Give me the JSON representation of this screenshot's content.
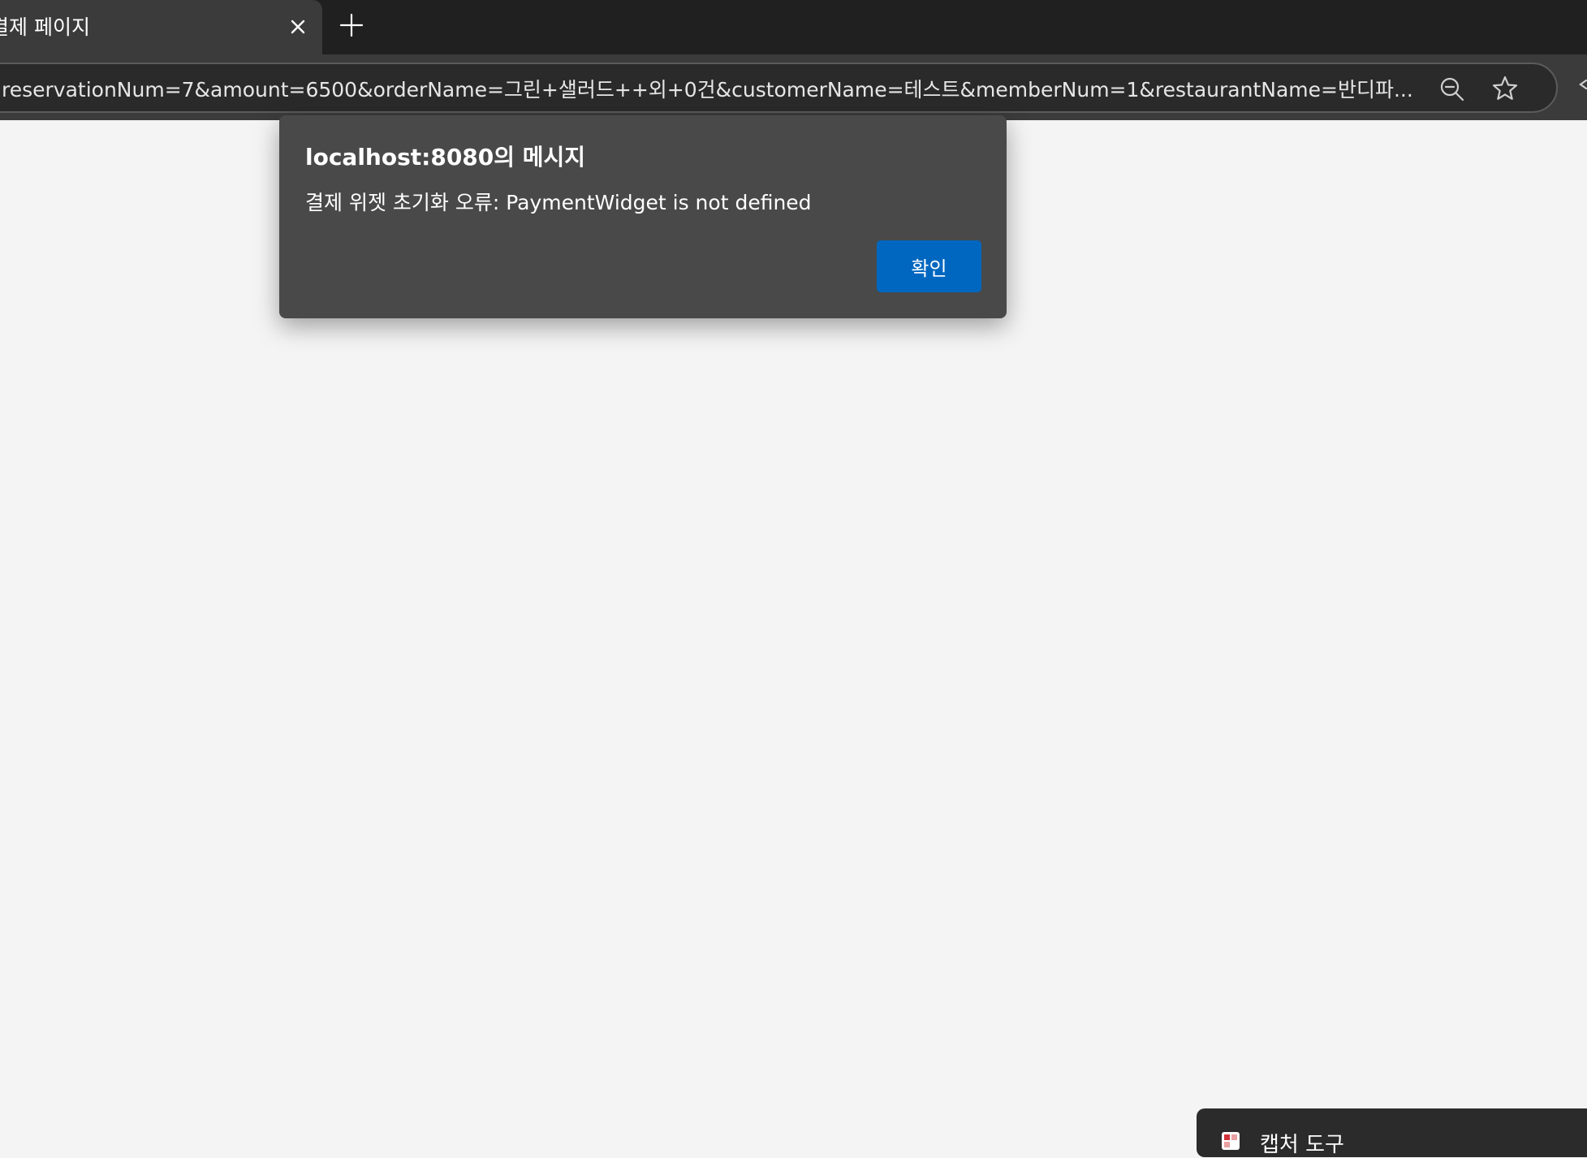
{
  "browser": {
    "tab": {
      "title": "결제 페이지",
      "close_icon": "close-icon"
    },
    "new_tab_icon": "plus-icon",
    "address_bar": {
      "url": "reservationNum=7&amount=6500&orderName=그린+샐러드++외+0건&customerName=테스트&memberNum=1&restaurantName=반디파...",
      "zoom_icon": "zoom-out-icon",
      "favorite_icon": "star-icon"
    }
  },
  "dialog": {
    "title": "localhost:8080의 메시지",
    "message": "결제 위젯 초기화 오류: PaymentWidget is not defined",
    "ok_label": "확인"
  },
  "snipping_tool": {
    "label": "캡처 도구"
  },
  "colors": {
    "tabbar_bg": "#202020",
    "toolbar_bg": "#3b3b3b",
    "dialog_bg": "#494949",
    "accent_button": "#0067c0",
    "page_bg": "#f4f4f4"
  }
}
